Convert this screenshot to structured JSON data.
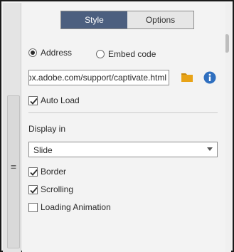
{
  "tabs": [
    {
      "label": "Style",
      "active": true
    },
    {
      "label": "Options",
      "active": false
    }
  ],
  "source": {
    "address_label": "Address",
    "address_selected": true,
    "embed_label": "Embed code",
    "embed_selected": false,
    "url_value": "http://helpx.adobe.com/support/captivate.html"
  },
  "icons": {
    "folder": "folder-icon",
    "info": "info-icon",
    "folder_color": "#e8a317",
    "info_color": "#2f6fbf"
  },
  "auto_load": {
    "label": "Auto Load",
    "checked": true
  },
  "display_in": {
    "label": "Display in",
    "selected": "Slide"
  },
  "options": [
    {
      "label": "Border",
      "checked": true
    },
    {
      "label": "Scrolling",
      "checked": true
    },
    {
      "label": "Loading Animation",
      "checked": false
    }
  ],
  "colors": {
    "active_tab": "#4c5f7f",
    "panel_bg": "#f3f3f3"
  }
}
